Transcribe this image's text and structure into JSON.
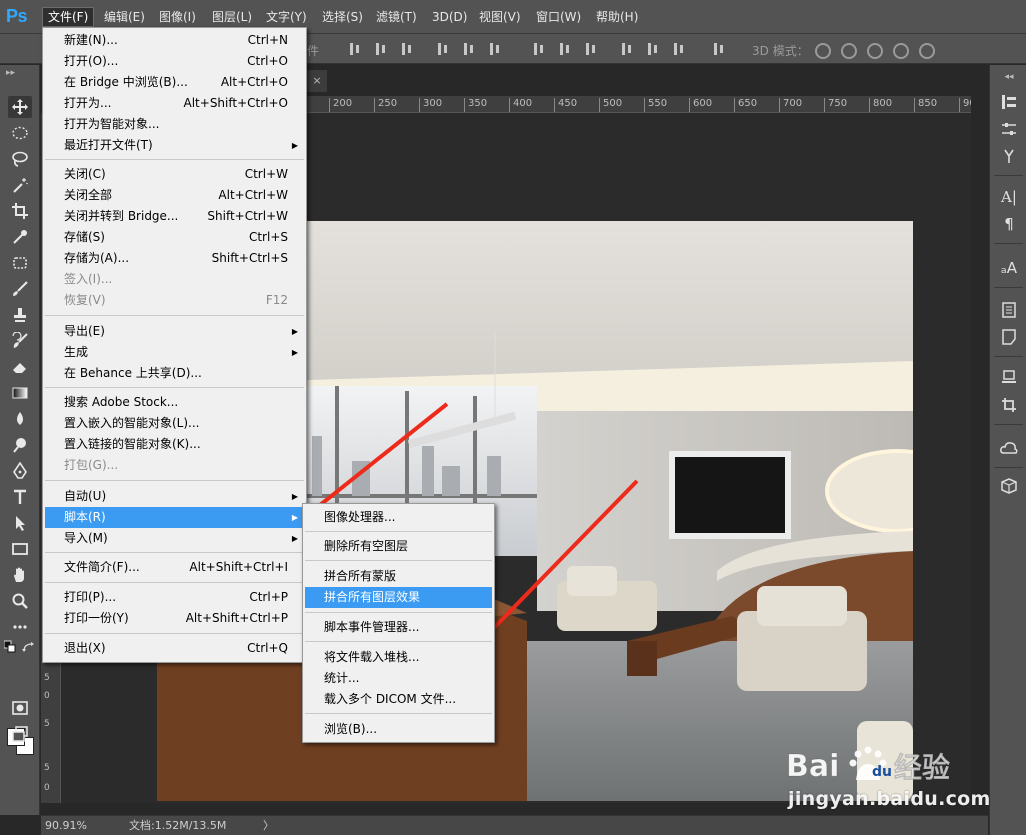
{
  "app": {
    "logo_text": "Ps"
  },
  "menubar": {
    "items": [
      {
        "label": "文件(F)",
        "active": true
      },
      {
        "label": "编辑(E)"
      },
      {
        "label": "图像(I)"
      },
      {
        "label": "图层(L)"
      },
      {
        "label": "文字(Y)"
      },
      {
        "label": "选择(S)"
      },
      {
        "label": "滤镜(T)"
      },
      {
        "label": "3D(D)"
      },
      {
        "label": "视图(V)"
      },
      {
        "label": "窗口(W)"
      },
      {
        "label": "帮助(H)"
      }
    ]
  },
  "options_bar": {
    "partial_label": "件",
    "mode_label": "3D 模式："
  },
  "ruler": {
    "h_ticks": [
      "200",
      "250",
      "300",
      "350",
      "400",
      "450",
      "500",
      "550",
      "600",
      "650",
      "700",
      "750",
      "800",
      "850",
      "90"
    ],
    "v_ticks": [
      "5",
      "0",
      "5",
      "5",
      "0"
    ]
  },
  "document": {
    "tab_close": "×"
  },
  "file_menu": {
    "items": [
      {
        "label": "新建(N)...",
        "shortcut": "Ctrl+N"
      },
      {
        "label": "打开(O)...",
        "shortcut": "Ctrl+O"
      },
      {
        "label": "在 Bridge 中浏览(B)...",
        "shortcut": "Alt+Ctrl+O"
      },
      {
        "label": "打开为...",
        "shortcut": "Alt+Shift+Ctrl+O"
      },
      {
        "label": "打开为智能对象..."
      },
      {
        "label": "最近打开文件(T)",
        "submenu": true
      },
      {
        "label": "关闭(C)",
        "shortcut": "Ctrl+W"
      },
      {
        "label": "关闭全部",
        "shortcut": "Alt+Ctrl+W"
      },
      {
        "label": "关闭并转到 Bridge...",
        "shortcut": "Shift+Ctrl+W"
      },
      {
        "label": "存储(S)",
        "shortcut": "Ctrl+S"
      },
      {
        "label": "存储为(A)...",
        "shortcut": "Shift+Ctrl+S"
      },
      {
        "label": "签入(I)...",
        "disabled": true
      },
      {
        "label": "恢复(V)",
        "shortcut": "F12",
        "disabled": true
      },
      {
        "label": "导出(E)",
        "submenu": true
      },
      {
        "label": "生成",
        "submenu": true
      },
      {
        "label": "在 Behance 上共享(D)..."
      },
      {
        "label": "搜索 Adobe Stock..."
      },
      {
        "label": "置入嵌入的智能对象(L)..."
      },
      {
        "label": "置入链接的智能对象(K)..."
      },
      {
        "label": "打包(G)...",
        "disabled": true
      },
      {
        "label": "自动(U)",
        "submenu": true
      },
      {
        "label": "脚本(R)",
        "submenu": true,
        "highlighted": true
      },
      {
        "label": "导入(M)",
        "submenu": true
      },
      {
        "label": "文件简介(F)...",
        "shortcut": "Alt+Shift+Ctrl+I"
      },
      {
        "label": "打印(P)...",
        "shortcut": "Ctrl+P"
      },
      {
        "label": "打印一份(Y)",
        "shortcut": "Alt+Shift+Ctrl+P"
      },
      {
        "label": "退出(X)",
        "shortcut": "Ctrl+Q"
      }
    ]
  },
  "scripts_menu": {
    "items": [
      {
        "label": "图像处理器..."
      },
      {
        "label": "删除所有空图层"
      },
      {
        "label": "拼合所有蒙版"
      },
      {
        "label": "拼合所有图层效果",
        "highlighted": true
      },
      {
        "label": "脚本事件管理器..."
      },
      {
        "label": "将文件载入堆栈..."
      },
      {
        "label": "统计..."
      },
      {
        "label": "载入多个 DICOM 文件..."
      },
      {
        "label": "浏览(B)..."
      }
    ]
  },
  "status": {
    "zoom": "90.91%",
    "doc_info": "文档:1.52M/13.5M",
    "arrow": "〉"
  },
  "watermark": {
    "brand": "Baidu经验",
    "url": "jingyan.baidu.com"
  },
  "colors": {
    "highlight": "#3b9bf3",
    "annotation_arrow": "#ee2b1b",
    "ui_gray": "#535353"
  }
}
